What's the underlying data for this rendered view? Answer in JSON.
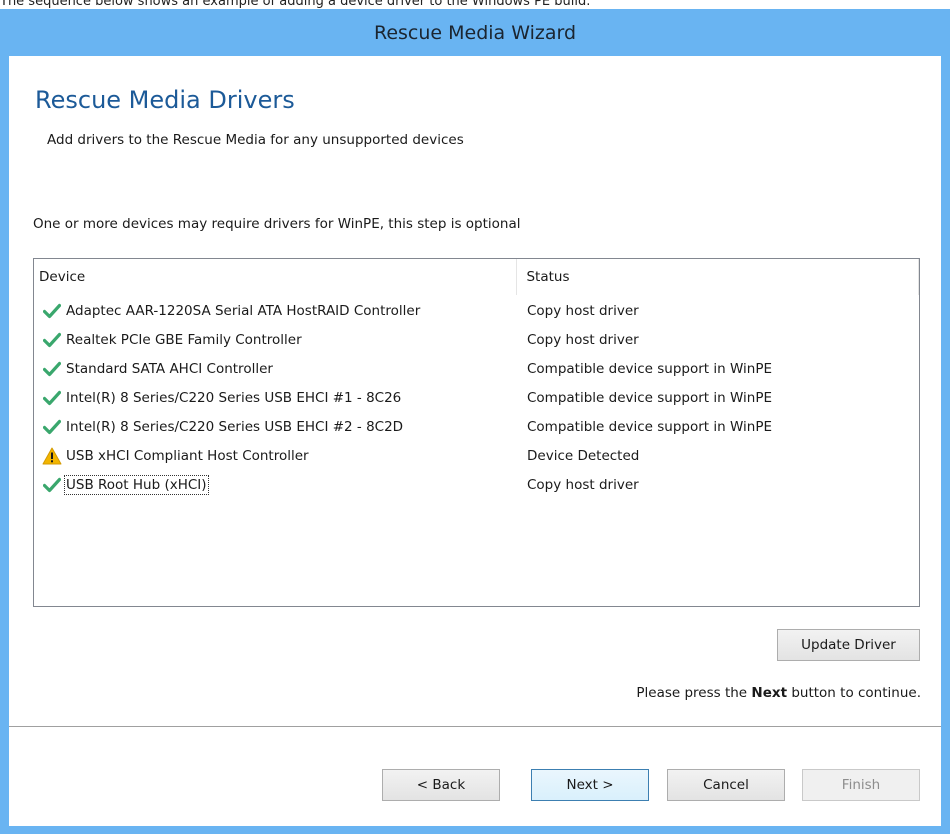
{
  "caption": "The sequence below shows an example of adding a device driver to the Windows PE build.",
  "window": {
    "title": "Rescue Media Wizard"
  },
  "page": {
    "heading": "Rescue Media Drivers",
    "subheading": "Add drivers to the Rescue Media for any unsupported devices",
    "info": "One or more devices may require drivers for WinPE, this step is optional"
  },
  "listview": {
    "columns": {
      "device": "Device",
      "status": "Status"
    },
    "rows": [
      {
        "icon": "check-icon",
        "device": "Adaptec AAR-1220SA Serial ATA HostRAID Controller",
        "status": "Copy host driver"
      },
      {
        "icon": "check-icon",
        "device": "Realtek PCIe GBE Family Controller",
        "status": "Copy host driver"
      },
      {
        "icon": "check-icon",
        "device": "Standard SATA AHCI Controller",
        "status": "Compatible device support in WinPE"
      },
      {
        "icon": "check-icon",
        "device": "Intel(R) 8 Series/C220 Series USB EHCI #1 - 8C26",
        "status": "Compatible device support in WinPE"
      },
      {
        "icon": "check-icon",
        "device": "Intel(R) 8 Series/C220 Series USB EHCI #2 - 8C2D",
        "status": "Compatible device support in WinPE"
      },
      {
        "icon": "warning-icon",
        "device": "USB xHCI Compliant Host Controller",
        "status": "Device Detected"
      },
      {
        "icon": "check-icon",
        "device": "USB Root Hub (xHCI)",
        "status": "Copy host driver"
      }
    ]
  },
  "buttons": {
    "update_driver": "Update Driver",
    "back": "< Back",
    "next": "Next >",
    "cancel": "Cancel",
    "finish": "Finish"
  },
  "footer": {
    "continue_prefix": "Please press the ",
    "continue_bold": "Next",
    "continue_suffix": "  button to continue."
  },
  "colors": {
    "title_bar": "#69b4f2",
    "heading": "#1c5a98",
    "check": "#3aa76d",
    "warning": "#f2b500"
  }
}
